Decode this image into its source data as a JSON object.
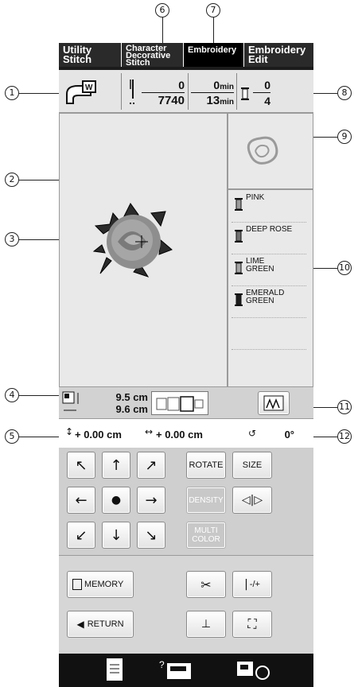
{
  "tabs": [
    {
      "line1": "Utility",
      "line2": "Stitch",
      "line3": ""
    },
    {
      "line1": "Character",
      "line2": "Decorative",
      "line3": "Stitch"
    },
    {
      "line1": "Embroidery",
      "line2": "",
      "line3": ""
    },
    {
      "line1": "Embroidery",
      "line2": "Edit",
      "line3": ""
    }
  ],
  "status": {
    "stitch_current": "0",
    "stitch_total": "7740",
    "time_current": "0",
    "time_current_unit": "min",
    "time_total": "13",
    "time_total_unit": "min",
    "color_current": "0",
    "color_total": "4"
  },
  "colors": [
    {
      "name1": "PINK",
      "name2": "",
      "hex": "#9a9a9a"
    },
    {
      "name1": "DEEP ROSE",
      "name2": "",
      "hex": "#707070"
    },
    {
      "name1": "LIME",
      "name2": "GREEN",
      "hex": "#a4a4a4"
    },
    {
      "name1": "EMERALD",
      "name2": "GREEN",
      "hex": "#1e1e1e"
    }
  ],
  "size": {
    "height": "9.5 cm",
    "width": "9.6 cm"
  },
  "position": {
    "vertical": "+ 0.00 cm",
    "horizontal": "+ 0.00 cm",
    "angle": "0°"
  },
  "buttons": {
    "rotate": "ROTATE",
    "size": "SIZE",
    "density": "DENSITY",
    "multi1": "MULTI",
    "multi2": "COLOR",
    "memory": "MEMORY",
    "return": "RETURN",
    "needle": "-/+"
  },
  "callouts": [
    "1",
    "2",
    "3",
    "4",
    "5",
    "6",
    "7",
    "8",
    "9",
    "10",
    "11",
    "12"
  ]
}
